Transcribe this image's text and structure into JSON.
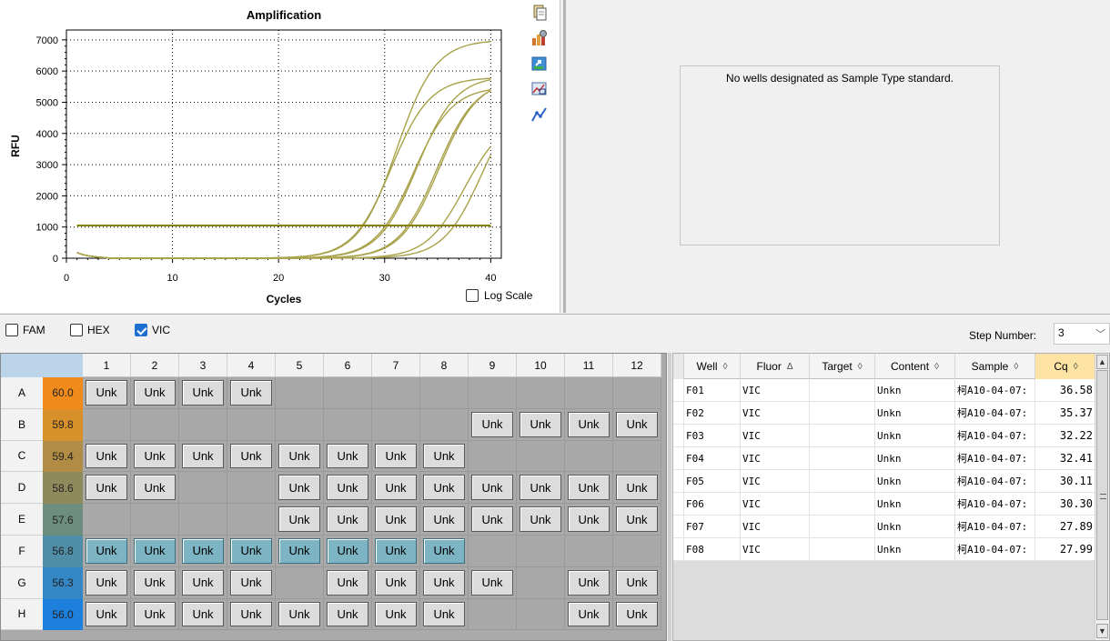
{
  "chart": {
    "title": "Amplification",
    "ylabel": "RFU",
    "xlabel": "Cycles",
    "log_scale_label": "Log Scale",
    "log_scale_checked": false
  },
  "chart_data": {
    "type": "line",
    "title": "Amplification",
    "xlabel": "Cycles",
    "ylabel": "RFU",
    "xlim": [
      0,
      41
    ],
    "ylim": [
      0,
      7200
    ],
    "x_ticks": [
      0,
      10,
      20,
      30,
      40
    ],
    "y_ticks": [
      0,
      1000,
      2000,
      3000,
      4000,
      5000,
      6000,
      7000
    ],
    "grid": "dotted",
    "threshold": 1050,
    "line_color": "#a8a24a",
    "threshold_color": "#8a8000",
    "series": [
      {
        "well": "F01",
        "cq": 36.58,
        "plateau": 5400
      },
      {
        "well": "F02",
        "cq": 35.37,
        "plateau": 4500
      },
      {
        "well": "F03",
        "cq": 32.22,
        "plateau": 5700
      },
      {
        "well": "F04",
        "cq": 32.41,
        "plateau": 5750
      },
      {
        "well": "F05",
        "cq": 30.11,
        "plateau": 5500
      },
      {
        "well": "F06",
        "cq": 30.3,
        "plateau": 5850
      },
      {
        "well": "F07",
        "cq": 27.89,
        "plateau": 5800
      },
      {
        "well": "F08",
        "cq": 27.99,
        "plateau": 7000
      }
    ]
  },
  "standard_panel": {
    "message": "No wells designated as Sample Type standard."
  },
  "tool_icons": [
    "copy-icon",
    "chart-settings-icon",
    "export-icon",
    "zoom-chart-icon",
    "curve-icon"
  ],
  "fluors": [
    {
      "label": "FAM",
      "checked": false
    },
    {
      "label": "HEX",
      "checked": false
    },
    {
      "label": "VIC",
      "checked": true
    }
  ],
  "step": {
    "label": "Step Number:",
    "value": "3"
  },
  "plate": {
    "columns": [
      "1",
      "2",
      "3",
      "4",
      "5",
      "6",
      "7",
      "8",
      "9",
      "10",
      "11",
      "12"
    ],
    "rows": [
      {
        "label": "A",
        "temp": "60.0",
        "color": "#f08a1a",
        "wells": [
          1,
          1,
          1,
          1,
          0,
          0,
          0,
          0,
          0,
          0,
          0,
          0
        ]
      },
      {
        "label": "B",
        "temp": "59.8",
        "color": "#d8902a",
        "wells": [
          0,
          0,
          0,
          0,
          0,
          0,
          0,
          0,
          1,
          1,
          1,
          1
        ]
      },
      {
        "label": "C",
        "temp": "59.4",
        "color": "#b08c44",
        "wells": [
          1,
          1,
          1,
          1,
          1,
          1,
          1,
          1,
          0,
          0,
          0,
          0
        ]
      },
      {
        "label": "D",
        "temp": "58.6",
        "color": "#8f8a5c",
        "wells": [
          1,
          1,
          0,
          0,
          1,
          1,
          1,
          1,
          1,
          1,
          1,
          1
        ]
      },
      {
        "label": "E",
        "temp": "57.6",
        "color": "#6d8d7e",
        "wells": [
          0,
          0,
          0,
          0,
          1,
          1,
          1,
          1,
          1,
          1,
          1,
          1
        ]
      },
      {
        "label": "F",
        "temp": "56.8",
        "color": "#4f8ea6",
        "wells": [
          2,
          2,
          2,
          2,
          2,
          2,
          2,
          2,
          0,
          0,
          0,
          0
        ]
      },
      {
        "label": "G",
        "temp": "56.3",
        "color": "#3486c4",
        "wells": [
          1,
          1,
          1,
          1,
          0,
          1,
          1,
          1,
          1,
          0,
          1,
          1
        ]
      },
      {
        "label": "H",
        "temp": "56.0",
        "color": "#1d80dc",
        "wells": [
          1,
          1,
          1,
          1,
          1,
          1,
          1,
          1,
          0,
          0,
          1,
          1
        ]
      }
    ],
    "well_label": "Unk"
  },
  "table": {
    "headers": [
      {
        "label": "Well",
        "sort": "◊"
      },
      {
        "label": "Fluor",
        "sort": "Δ"
      },
      {
        "label": "Target",
        "sort": "◊"
      },
      {
        "label": "Content",
        "sort": "◊"
      },
      {
        "label": "Sample",
        "sort": "◊"
      },
      {
        "label": "Cq",
        "sort": "◊"
      }
    ],
    "rows": [
      {
        "well": "F01",
        "fluor": "VIC",
        "target": "",
        "content": "Unkn",
        "sample": "柯A10-04-07:",
        "cq": "36.58"
      },
      {
        "well": "F02",
        "fluor": "VIC",
        "target": "",
        "content": "Unkn",
        "sample": "柯A10-04-07:",
        "cq": "35.37"
      },
      {
        "well": "F03",
        "fluor": "VIC",
        "target": "",
        "content": "Unkn",
        "sample": "柯A10-04-07:",
        "cq": "32.22"
      },
      {
        "well": "F04",
        "fluor": "VIC",
        "target": "",
        "content": "Unkn",
        "sample": "柯A10-04-07:",
        "cq": "32.41"
      },
      {
        "well": "F05",
        "fluor": "VIC",
        "target": "",
        "content": "Unkn",
        "sample": "柯A10-04-07:",
        "cq": "30.11"
      },
      {
        "well": "F06",
        "fluor": "VIC",
        "target": "",
        "content": "Unkn",
        "sample": "柯A10-04-07:",
        "cq": "30.30"
      },
      {
        "well": "F07",
        "fluor": "VIC",
        "target": "",
        "content": "Unkn",
        "sample": "柯A10-04-07:",
        "cq": "27.89"
      },
      {
        "well": "F08",
        "fluor": "VIC",
        "target": "",
        "content": "Unkn",
        "sample": "柯A10-04-07:",
        "cq": "27.99"
      }
    ]
  }
}
